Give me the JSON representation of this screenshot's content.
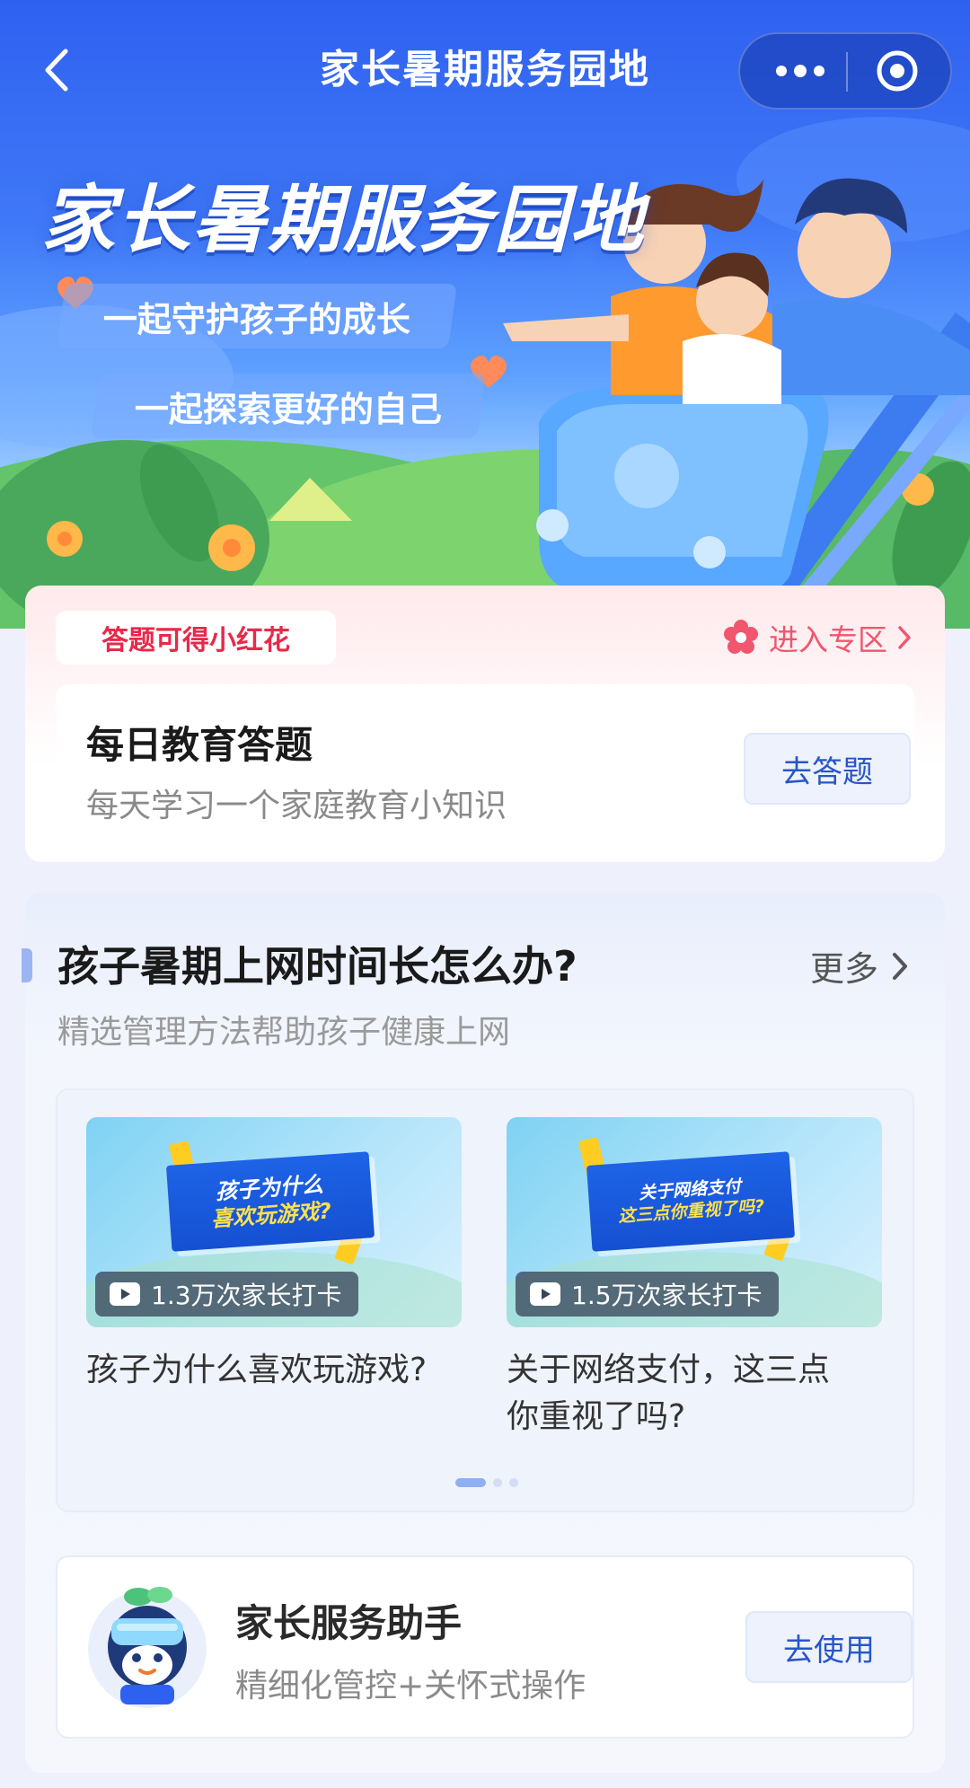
{
  "nav": {
    "title": "家长暑期服务园地"
  },
  "hero": {
    "title": "家长暑期服务园地",
    "slogans": [
      "一起守护孩子的成长",
      "一起探索更好的自己"
    ]
  },
  "quiz": {
    "badge": "答题可得小红花",
    "enter_label": "进入专区",
    "title": "每日教育答题",
    "description": "每天学习一个家庭教育小知识",
    "button_label": "去答题"
  },
  "internet_section": {
    "title": "孩子暑期上网时间长怎么办?",
    "subtitle": "精选管理方法帮助孩子健康上网",
    "more_label": "更多",
    "videos": [
      {
        "thumb_line1": "孩子为什么",
        "thumb_line2": "喜欢玩游戏?",
        "checkin": "1.3万次家长打卡",
        "title": "孩子为什么喜欢玩游戏?"
      },
      {
        "thumb_line1": "关于网络支付",
        "thumb_line2": "这三点你重视了吗?",
        "checkin": "1.5万次家长打卡",
        "title": "关于网络支付，这三点你重视了吗?"
      }
    ],
    "pagination": {
      "total": 3,
      "active": 1
    }
  },
  "assistant": {
    "title": "家长服务助手",
    "description": "精细化管控+关怀式操作",
    "button_label": "去使用"
  },
  "colors": {
    "brand_blue": "#2f61f0",
    "accent_red": "#e8294a",
    "button_text": "#2856c8"
  }
}
